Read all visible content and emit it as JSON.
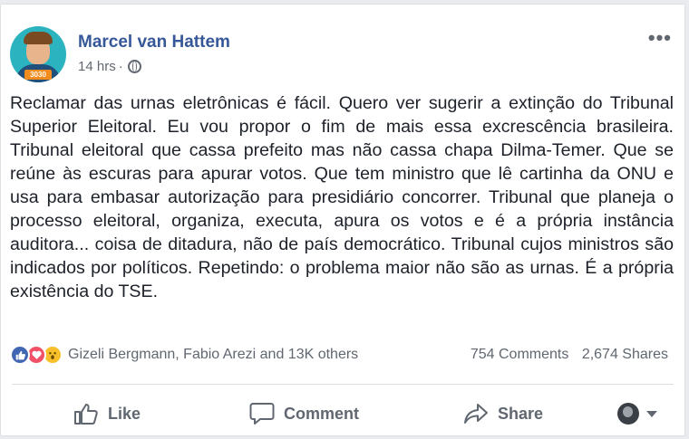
{
  "post": {
    "author": "Marcel van Hattem",
    "time": "14 hrs",
    "time_separator": "·",
    "privacy_icon": "globe-icon",
    "avatar_badge": "3030",
    "more_label": "•••",
    "text": "Reclamar das urnas eletrônicas é fácil. Quero ver sugerir a extinção do Tribunal Superior Eleitoral. Eu vou propor o fim de mais essa excrescência brasileira. Tribunal eleitoral que cassa prefeito mas não cassa chapa Dilma-Temer. Que se reúne às escuras para apurar votos. Que tem ministro que lê cartinha da ONU e usa para embasar autorização para presidiário concorrer. Tribunal que planeja o processo eleitoral, organiza, executa, apura os votos e é a própria instância auditora... coisa de ditadura, não de país democrático. Tribunal cujos ministros são indicados por políticos. Repetindo: o problema maior não são as urnas. É a própria existência do TSE."
  },
  "reactions": {
    "icons": [
      "like-icon",
      "love-icon",
      "wow-icon"
    ],
    "summary": "Gizeli Bergmann, Fabio Arezi and 13K others",
    "comments": "754 Comments",
    "shares": "2,674 Shares"
  },
  "actions": {
    "like": "Like",
    "comment": "Comment",
    "share": "Share"
  },
  "colors": {
    "author_link": "#365899",
    "like_blue": "#4267b2",
    "love_red": "#f25268",
    "wow_yellow": "#f7c02a",
    "muted_text": "#606770"
  }
}
